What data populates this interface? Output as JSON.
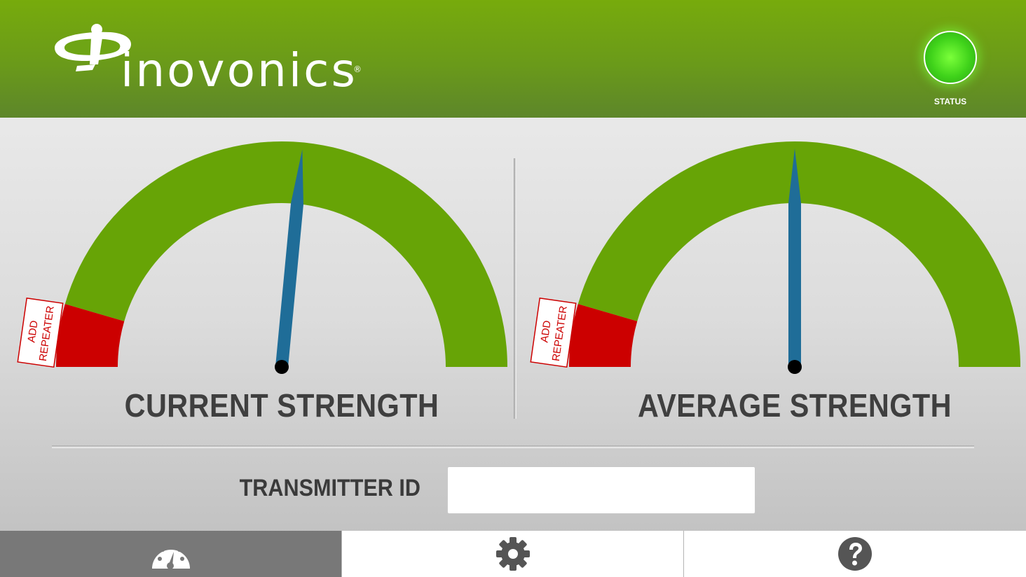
{
  "header": {
    "brand": "inovonics",
    "registered_mark": "®",
    "status_label": "STATUS",
    "status_color": "#44dd1a"
  },
  "colors": {
    "header_green": "#6ea515",
    "gauge_green": "#67a406",
    "gauge_red": "#cc0000",
    "needle_blue": "#1f6d98"
  },
  "gauges": [
    {
      "title": "CURRENT STRENGTH",
      "zone_label_line1": "ADD",
      "zone_label_line2": "REPEATER",
      "red_zone_fraction": 0.09,
      "needle_fraction": 0.53
    },
    {
      "title": "AVERAGE STRENGTH",
      "zone_label_line1": "ADD",
      "zone_label_line2": "REPEATER",
      "red_zone_fraction": 0.09,
      "needle_fraction": 0.5
    }
  ],
  "transmitter": {
    "label": "TRANSMITTER ID",
    "value": ""
  },
  "tabs": [
    {
      "icon": "gauge-icon",
      "selected": true
    },
    {
      "icon": "gear-icon",
      "selected": false
    },
    {
      "icon": "help-icon",
      "selected": false
    }
  ]
}
